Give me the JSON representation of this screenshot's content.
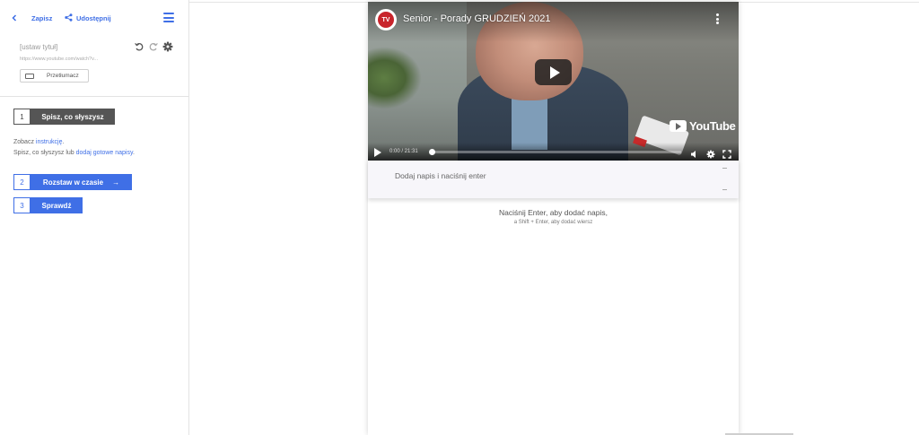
{
  "sidebar": {
    "back_icon": "chevron-left-icon",
    "save_label": "Zapisz",
    "share_label": "Udostępnij",
    "share_icon": "share-icon",
    "menu_icon": "hamburger-menu-icon",
    "title_placeholder": "[ustaw tytuł]",
    "url": "https://www.youtube.com/watch?v...",
    "translate_label": "Przetłumacz",
    "translate_icon": "translate-icon",
    "steps": [
      {
        "number": "1",
        "label": "Spisz, co słyszysz"
      },
      {
        "number": "2",
        "label": "Rozstaw w czasie",
        "arrow": "→"
      },
      {
        "number": "3",
        "label": "Sprawdź"
      }
    ],
    "instructions": {
      "line1_prefix": "Zobacz ",
      "line1_link": "instrukcję",
      "line1_suffix": ".",
      "line2_prefix": "Spisz, co słyszysz lub ",
      "line2_link": "dodaj gotowe napisy",
      "line2_suffix": "."
    }
  },
  "video": {
    "channel_logo_text": "TV",
    "title": "Senior - Porady GRUDZIEŃ 2021",
    "brand": "YouTube",
    "time": "0:00 / 21:31",
    "progress": 0.0
  },
  "editor": {
    "subtitle_placeholder": "Dodaj napis i naciśnij enter",
    "hint_main": "Naciśnij Enter, aby dodać napis,",
    "hint_sub": "a Shift + Enter, aby dodać wiersz"
  },
  "colors": {
    "accent": "#3f6fe6",
    "step_active": "#555555",
    "youtube_red": "#c8242b"
  }
}
